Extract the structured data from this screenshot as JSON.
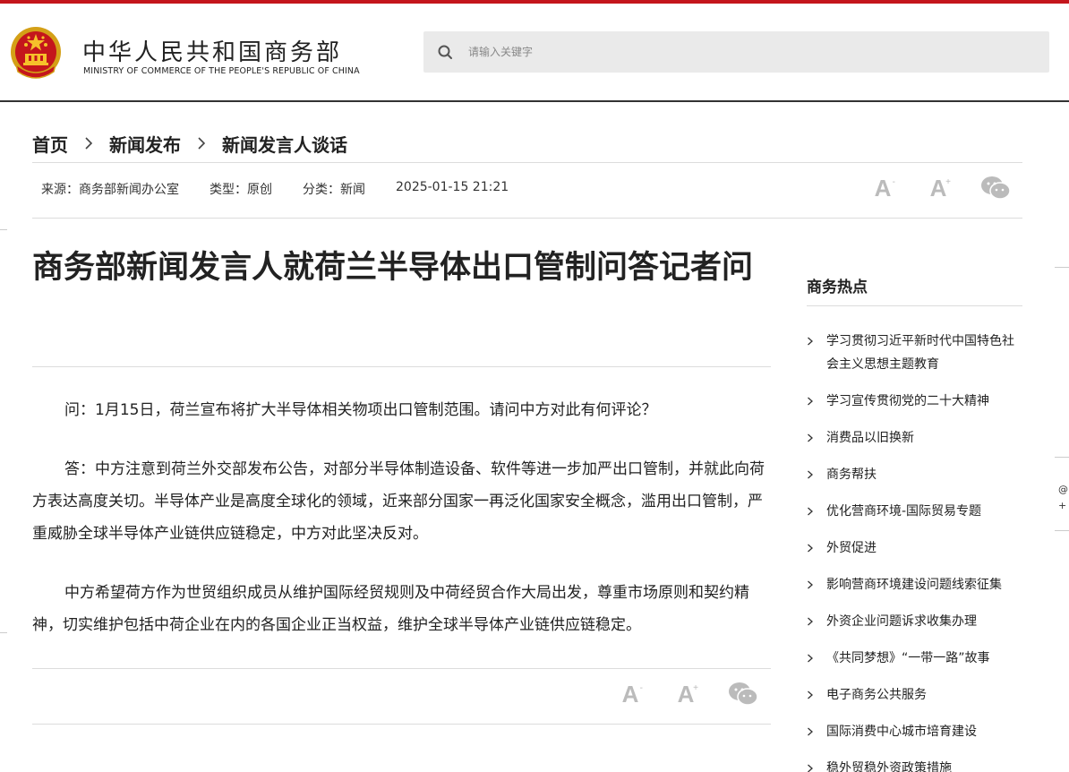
{
  "header": {
    "title_cn": "中华人民共和国商务部",
    "title_en": "MINISTRY OF COMMERCE OF THE PEOPLE'S REPUBLIC OF CHINA",
    "search_placeholder": "请输入关键字"
  },
  "breadcrumb": [
    {
      "label": "首页"
    },
    {
      "label": "新闻发布"
    },
    {
      "label": "新闻发言人谈话"
    }
  ],
  "meta": {
    "source": "来源：商务部新闻办公室",
    "type": "类型：原创",
    "category": "分类：新闻",
    "datetime": "2025-01-15 21:21"
  },
  "tools": {
    "font_decrease": "A",
    "font_increase": "A",
    "font_increase_sup": "+"
  },
  "article": {
    "title": "商务部新闻发言人就荷兰半导体出口管制问答记者问",
    "paragraphs": [
      "问：1月15日，荷兰宣布将扩大半导体相关物项出口管制范围。请问中方对此有何评论？",
      "答：中方注意到荷兰外交部发布公告，对部分半导体制造设备、软件等进一步加严出口管制，并就此向荷方表达高度关切。半导体产业是高度全球化的领域，近来部分国家一再泛化国家安全概念，滥用出口管制，严重威胁全球半导体产业链供应链稳定，中方对此坚决反对。",
      "中方希望荷方作为世贸组织成员从维护国际经贸规则及中荷经贸合作大局出发，尊重市场原则和契约精神，切实维护包括中荷企业在内的各国企业正当权益，维护全球半导体产业链供应链稳定。"
    ]
  },
  "sidebar": {
    "title": "商务热点",
    "items": [
      {
        "label": "学习贯彻习近平新时代中国特色社会主义思想主题教育"
      },
      {
        "label": "学习宣传贯彻党的二十大精神"
      },
      {
        "label": "消费品以旧换新"
      },
      {
        "label": "商务帮扶"
      },
      {
        "label": "优化营商环境-国际贸易专题"
      },
      {
        "label": "外贸促进"
      },
      {
        "label": "影响营商环境建设问题线索征集"
      },
      {
        "label": "外资企业问题诉求收集办理"
      },
      {
        "label": "《共同梦想》“一带一路”故事"
      },
      {
        "label": "电子商务公共服务"
      },
      {
        "label": "国际消费中心城市培育建设"
      },
      {
        "label": "稳外贸稳外资政策措施"
      }
    ]
  },
  "edge": {
    "text1": "@",
    "text2": "+"
  },
  "colors": {
    "brand_red": "#c4161c",
    "icon_gray": "#bbbbbb",
    "divider": "#dcdcdc"
  }
}
